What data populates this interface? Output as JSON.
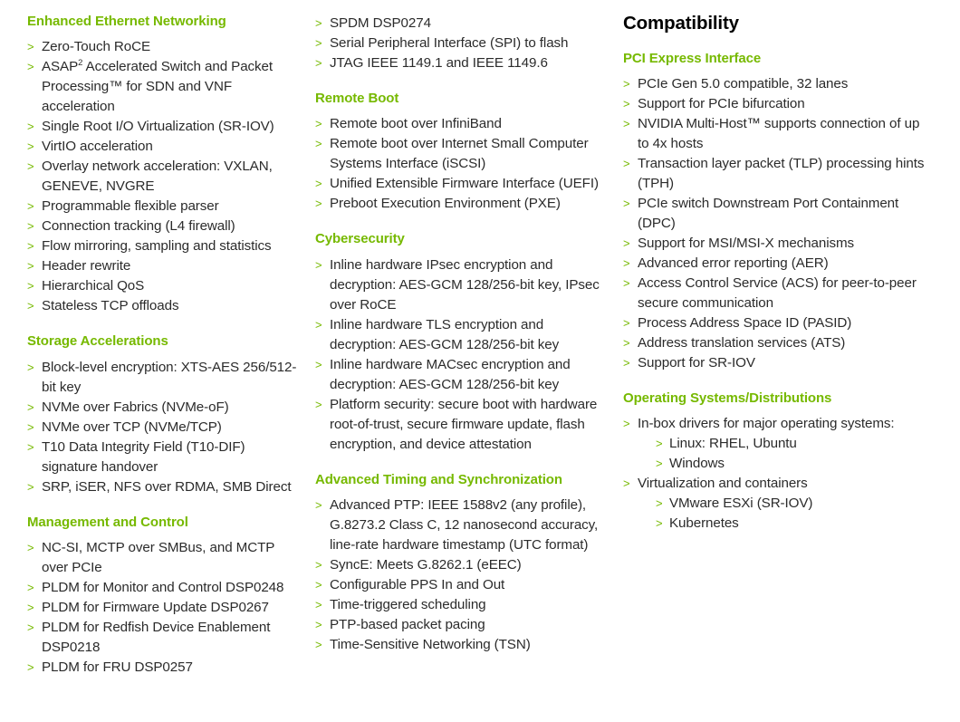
{
  "colors": {
    "brand_green": "#76b900",
    "body_text": "#2b2b2b",
    "title_black": "#000000",
    "background": "#ffffff"
  },
  "bullet_glyph": ">",
  "columns": [
    {
      "name": "column-left",
      "sections": [
        {
          "title": "Enhanced Ethernet Networking",
          "items": [
            {
              "text": "Zero-Touch RoCE"
            },
            {
              "html": "ASAP<sup>2</sup> Accelerated Switch and Packet Processing&#8482; for SDN and VNF acceleration"
            },
            {
              "text": "Single Root I/O Virtualization (SR-IOV)"
            },
            {
              "text": "VirtIO acceleration"
            },
            {
              "text": "Overlay network acceleration: VXLAN, GENEVE, NVGRE"
            },
            {
              "text": "Programmable flexible parser"
            },
            {
              "text": "Connection tracking (L4 firewall)"
            },
            {
              "text": "Flow mirroring, sampling and statistics"
            },
            {
              "text": "Header rewrite"
            },
            {
              "text": "Hierarchical QoS"
            },
            {
              "text": "Stateless TCP offloads"
            }
          ]
        },
        {
          "title": "Storage Accelerations",
          "items": [
            {
              "text": "Block-level encryption: XTS-AES 256/512-bit key"
            },
            {
              "text": "NVMe over Fabrics (NVMe-oF)"
            },
            {
              "text": "NVMe over TCP (NVMe/TCP)"
            },
            {
              "text": "T10 Data Integrity Field (T10-DIF) signature handover"
            },
            {
              "text": "SRP, iSER, NFS over RDMA, SMB Direct"
            }
          ]
        },
        {
          "title": "Management and Control",
          "items": [
            {
              "text": "NC-SI, MCTP over SMBus, and MCTP over PCIe"
            },
            {
              "text": "PLDM for Monitor and Control DSP0248"
            },
            {
              "text": "PLDM for Firmware Update DSP0267"
            },
            {
              "text": "PLDM for Redfish Device Enablement DSP0218"
            },
            {
              "text": "PLDM for FRU DSP0257"
            }
          ]
        }
      ]
    },
    {
      "name": "column-middle",
      "sections": [
        {
          "title": "",
          "items": [
            {
              "text": "SPDM DSP0274"
            },
            {
              "text": "Serial Peripheral Interface (SPI) to flash"
            },
            {
              "text": "JTAG IEEE 1149.1 and IEEE 1149.6"
            }
          ]
        },
        {
          "title": "Remote Boot",
          "items": [
            {
              "text": "Remote boot over InfiniBand"
            },
            {
              "text": "Remote boot over Internet Small Computer Systems Interface (iSCSI)"
            },
            {
              "text": "Unified Extensible Firmware Interface (UEFI)"
            },
            {
              "text": "Preboot Execution Environment (PXE)"
            }
          ]
        },
        {
          "title": "Cybersecurity",
          "items": [
            {
              "text": "Inline hardware IPsec encryption and decryption: AES-GCM 128/256-bit key, IPsec over RoCE"
            },
            {
              "text": "Inline hardware TLS encryption and decryption: AES-GCM 128/256-bit key"
            },
            {
              "text": "Inline hardware MACsec encryption and decryption: AES-GCM 128/256-bit key"
            },
            {
              "text": "Platform security: secure boot with hardware root-of-trust, secure firmware update, flash encryption, and device attestation"
            }
          ]
        },
        {
          "title": "Advanced Timing and Synchronization",
          "items": [
            {
              "text": "Advanced PTP: IEEE 1588v2 (any profile), G.8273.2 Class C, 12 nanosecond accuracy, line-rate hardware timestamp (UTC format)"
            },
            {
              "text": "SyncE: Meets G.8262.1 (eEEC)"
            },
            {
              "text": "Configurable PPS In and Out"
            },
            {
              "text": "Time-triggered scheduling"
            },
            {
              "text": "PTP-based packet pacing"
            },
            {
              "text": "Time-Sensitive Networking (TSN)"
            }
          ]
        }
      ]
    },
    {
      "name": "column-right",
      "main_title": "Compatibility",
      "sections": [
        {
          "title": "PCI Express Interface",
          "items": [
            {
              "text": "PCIe Gen 5.0 compatible, 32 lanes"
            },
            {
              "text": "Support for PCIe bifurcation"
            },
            {
              "html": "NVIDIA Multi-Host&#8482; supports connection of up to 4x hosts"
            },
            {
              "text": "Transaction layer packet (TLP) processing hints (TPH)"
            },
            {
              "text": "PCIe switch Downstream Port Containment (DPC)"
            },
            {
              "text": "Support for MSI/MSI-X mechanisms"
            },
            {
              "text": "Advanced error reporting (AER)"
            },
            {
              "text": "Access Control Service (ACS) for peer-to-peer secure communication"
            },
            {
              "text": "Process Address Space ID (PASID)"
            },
            {
              "text": "Address translation services (ATS)"
            },
            {
              "text": "Support for SR-IOV"
            }
          ]
        },
        {
          "title": "Operating Systems/Distributions",
          "items": [
            {
              "text": "In-box drivers for major operating systems:",
              "subitems": [
                {
                  "text": "Linux: RHEL, Ubuntu"
                },
                {
                  "text": "Windows"
                }
              ]
            },
            {
              "text": "Virtualization and containers",
              "subitems": [
                {
                  "text": "VMware ESXi (SR-IOV)"
                },
                {
                  "text": "Kubernetes"
                }
              ]
            }
          ]
        }
      ]
    }
  ]
}
